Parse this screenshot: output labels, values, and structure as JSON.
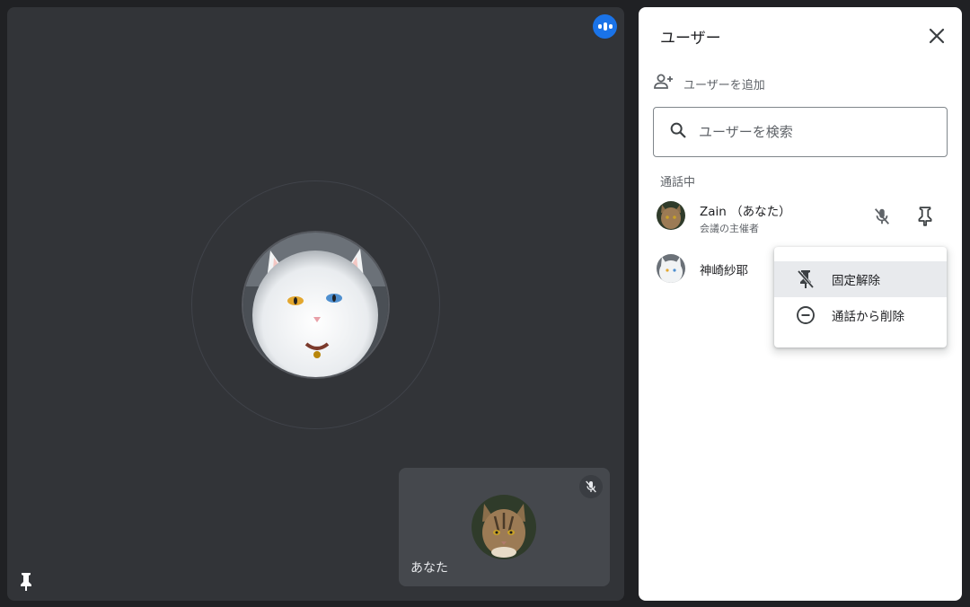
{
  "stage": {
    "self_tile_name": "あなた"
  },
  "panel": {
    "title": "ユーザー",
    "add_user_label": "ユーザーを追加",
    "search_placeholder": "ユーザーを検索",
    "section_label": "通話中",
    "users": [
      {
        "name": "Zain （あなた）",
        "role": "会議の主催者"
      },
      {
        "name": "神崎紗耶"
      }
    ]
  },
  "context_menu": {
    "items": [
      {
        "label": "固定解除",
        "icon": "unpin-icon"
      },
      {
        "label": "通話から削除",
        "icon": "remove-circle-icon"
      }
    ]
  },
  "icons": {
    "audio_indicator": "audio-indicator-icon",
    "mic_off": "mic-off-icon",
    "pin": "pin-icon",
    "close": "close-icon",
    "add_user": "add-user-icon",
    "search": "search-icon"
  },
  "colors": {
    "stage_bg": "#323438",
    "accent": "#1a73e8",
    "self_tile_bg": "#45484d",
    "panel_bg": "#ffffff"
  }
}
